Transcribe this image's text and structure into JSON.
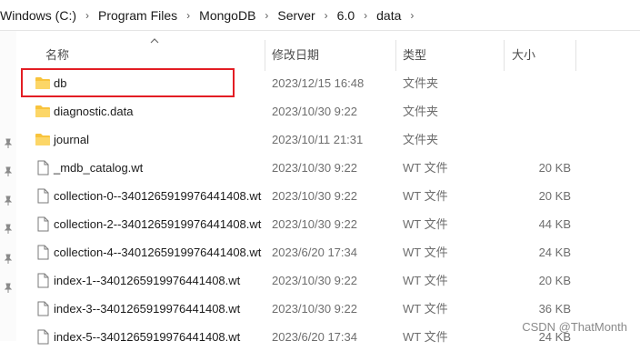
{
  "breadcrumb": [
    "Windows (C:)",
    "Program Files",
    "MongoDB",
    "Server",
    "6.0",
    "data"
  ],
  "columns": {
    "name": "名称",
    "date": "修改日期",
    "type": "类型",
    "size": "大小"
  },
  "files": [
    {
      "icon": "folder-icon",
      "name": "db",
      "date": "2023/12/15 16:48",
      "type": "文件夹",
      "size": ""
    },
    {
      "icon": "folder-icon",
      "name": "diagnostic.data",
      "date": "2023/10/30 9:22",
      "type": "文件夹",
      "size": ""
    },
    {
      "icon": "folder-icon",
      "name": "journal",
      "date": "2023/10/11 21:31",
      "type": "文件夹",
      "size": ""
    },
    {
      "icon": "file-icon",
      "name": "_mdb_catalog.wt",
      "date": "2023/10/30 9:22",
      "type": "WT 文件",
      "size": "20 KB"
    },
    {
      "icon": "file-icon",
      "name": "collection-0--3401265919976441408.wt",
      "date": "2023/10/30 9:22",
      "type": "WT 文件",
      "size": "20 KB"
    },
    {
      "icon": "file-icon",
      "name": "collection-2--3401265919976441408.wt",
      "date": "2023/10/30 9:22",
      "type": "WT 文件",
      "size": "44 KB"
    },
    {
      "icon": "file-icon",
      "name": "collection-4--3401265919976441408.wt",
      "date": "2023/6/20 17:34",
      "type": "WT 文件",
      "size": "24 KB"
    },
    {
      "icon": "file-icon",
      "name": "index-1--3401265919976441408.wt",
      "date": "2023/10/30 9:22",
      "type": "WT 文件",
      "size": "20 KB"
    },
    {
      "icon": "file-icon",
      "name": "index-3--3401265919976441408.wt",
      "date": "2023/10/30 9:22",
      "type": "WT 文件",
      "size": "36 KB"
    },
    {
      "icon": "file-icon",
      "name": "index-5--3401265919976441408.wt",
      "date": "2023/6/20 17:34",
      "type": "WT 文件",
      "size": "24 KB"
    }
  ],
  "watermark": "CSDN @ThatMonth",
  "colors": {
    "highlight_box": "#e31d24",
    "folder": "#f8c33c"
  }
}
